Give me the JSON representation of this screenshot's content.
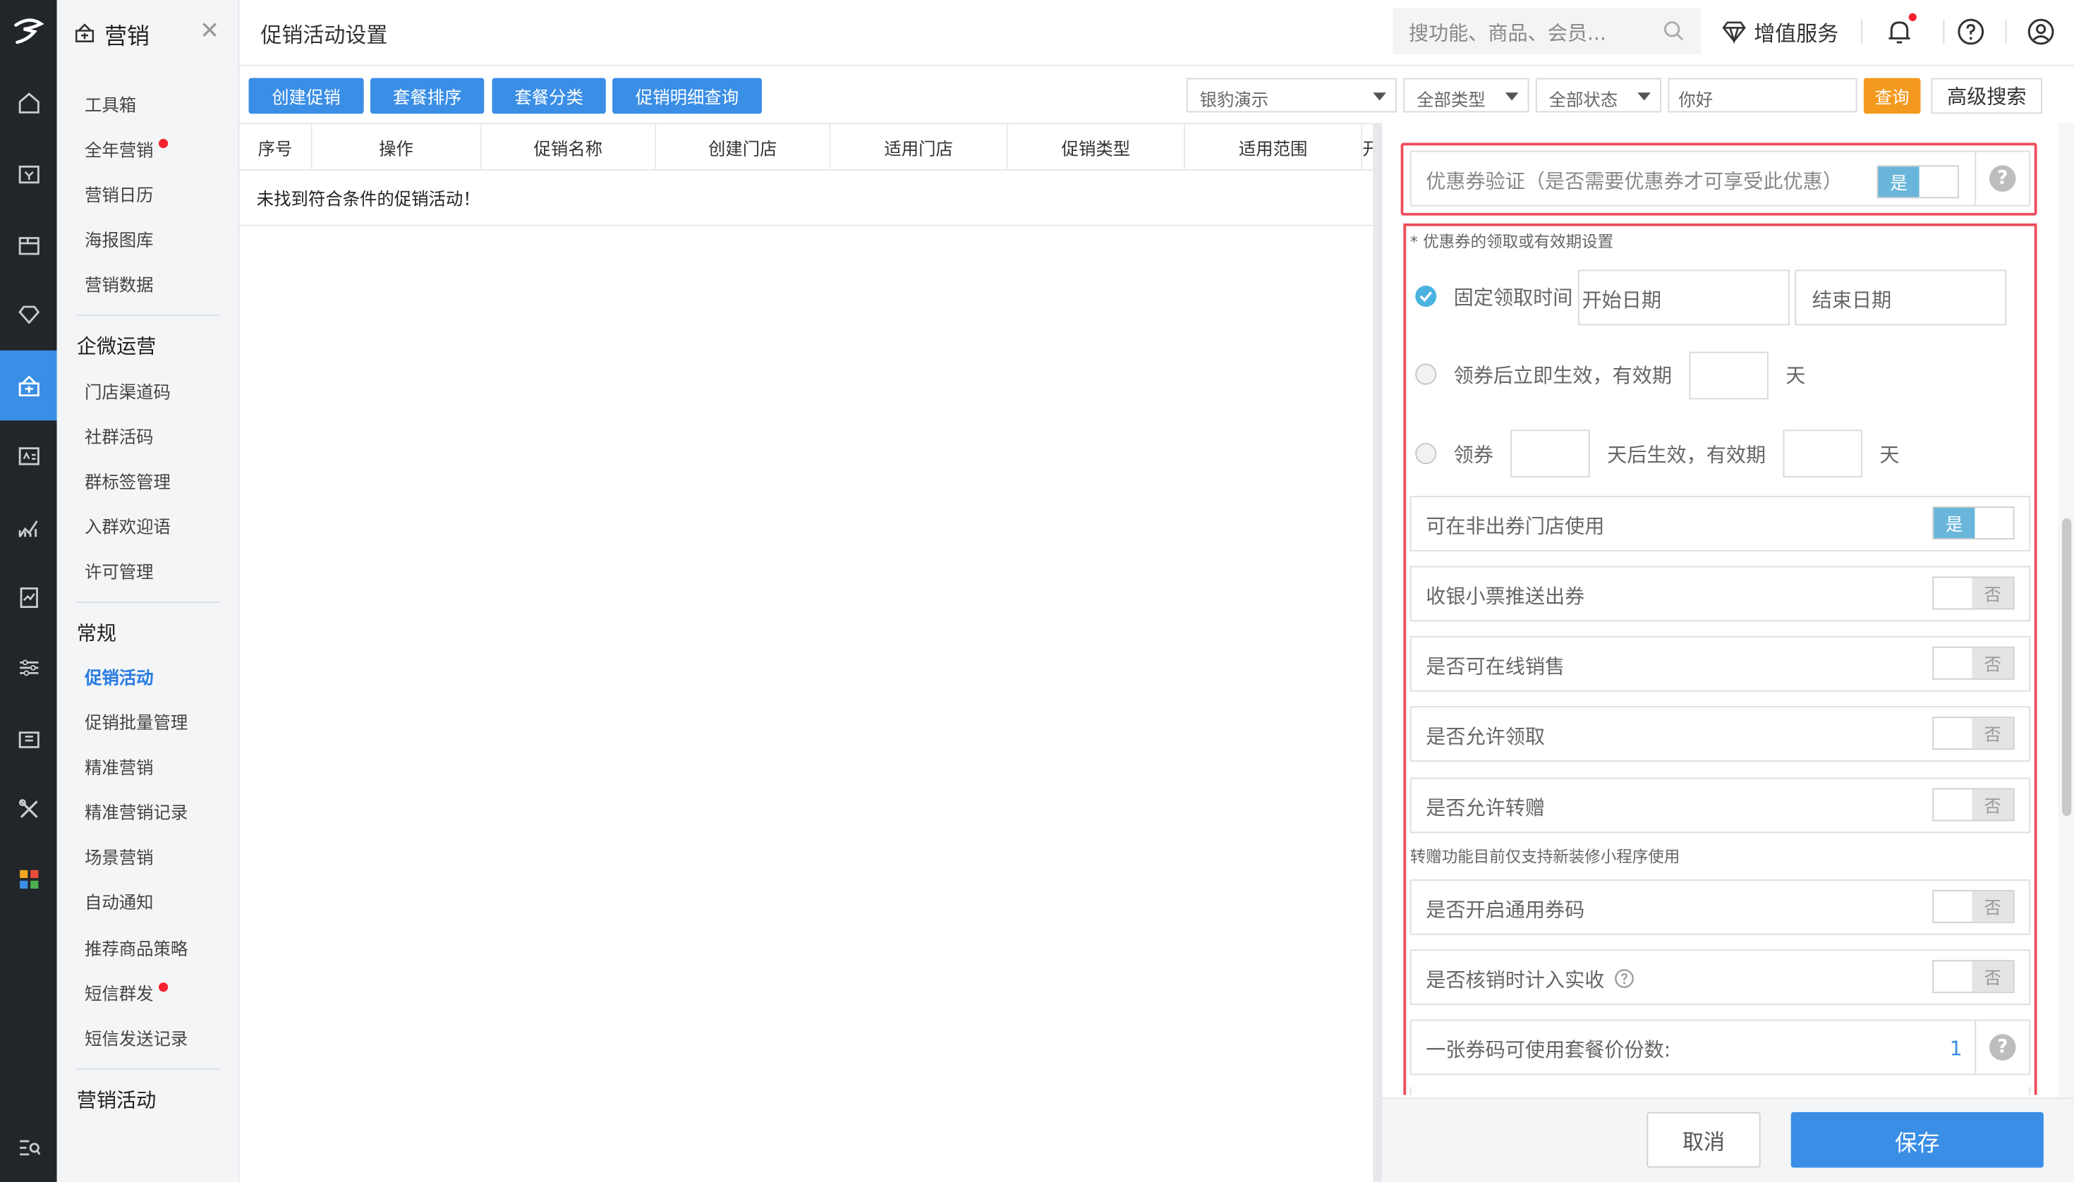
{
  "sidebar": {
    "title": "营销",
    "groups": [
      {
        "title": "",
        "items": [
          {
            "label": "工具箱",
            "dot": false
          },
          {
            "label": "全年营销",
            "dot": true
          },
          {
            "label": "营销日历",
            "dot": false
          },
          {
            "label": "海报图库",
            "dot": false
          },
          {
            "label": "营销数据",
            "dot": false
          }
        ]
      },
      {
        "title": "企微运营",
        "items": [
          {
            "label": "门店渠道码"
          },
          {
            "label": "社群活码"
          },
          {
            "label": "群标签管理"
          },
          {
            "label": "入群欢迎语"
          },
          {
            "label": "许可管理"
          }
        ]
      },
      {
        "title": "常规",
        "items": [
          {
            "label": "促销活动",
            "active": true
          },
          {
            "label": "促销批量管理"
          },
          {
            "label": "精准营销"
          },
          {
            "label": "精准营销记录"
          },
          {
            "label": "场景营销"
          },
          {
            "label": "自动通知"
          },
          {
            "label": "推荐商品策略"
          },
          {
            "label": "短信群发",
            "dot": true
          },
          {
            "label": "短信发送记录"
          }
        ]
      },
      {
        "title": "营销活动",
        "items": []
      }
    ]
  },
  "header": {
    "title": "促销活动设置",
    "search_placeholder": "搜功能、商品、会员...",
    "value_added": "增值服务"
  },
  "toolbar": {
    "buttons": [
      "创建促销",
      "套餐排序",
      "套餐分类",
      "促销明细查询"
    ],
    "store_select": "银豹演示",
    "type_select": "全部类型",
    "status_select": "全部状态",
    "keyword": "你好",
    "query": "查询",
    "advanced": "高级搜索"
  },
  "table": {
    "columns": [
      "序号",
      "操作",
      "促销名称",
      "创建门店",
      "适用门店",
      "促销类型",
      "适用范围",
      "开"
    ],
    "empty_text": "未找到符合条件的促销活动！"
  },
  "drawer": {
    "coupon_verify": {
      "label": "优惠券验证（是否需要优惠券才可享受此优惠）",
      "value": "是"
    },
    "period_title": "* 优惠券的领取或有效期设置",
    "fixed_time_label": "固定领取时间",
    "start_placeholder": "开始日期",
    "end_placeholder": "结束日期",
    "immediate_label": "领券后立即生效，有效期",
    "day_unit": "天",
    "delay_label_1": "领券",
    "delay_label_2": "天后生效，有效期",
    "toggles": [
      {
        "label": "可在非出券门店使用",
        "value": "是"
      },
      {
        "label": "收银小票推送出券",
        "value": "否"
      },
      {
        "label": "是否可在线销售",
        "value": "否"
      },
      {
        "label": "是否允许领取",
        "value": "否"
      },
      {
        "label": "是否允许转赠",
        "value": "否"
      }
    ],
    "transfer_note": "转赠功能目前仅支持新装修小程序使用",
    "toggles2": [
      {
        "label": "是否开启通用券码",
        "value": "否"
      },
      {
        "label": "是否核销时计入实收",
        "value": "否"
      }
    ],
    "per_code_label": "一张券码可使用套餐价份数:",
    "per_code_value": "1",
    "cancel": "取消",
    "save": "保存"
  },
  "colors": {
    "accent": "#3a8ee6",
    "rail": "#22262b",
    "highlight": "#ee4d5c",
    "query": "#f39a1e",
    "toggle_on": "#6ab6da"
  }
}
